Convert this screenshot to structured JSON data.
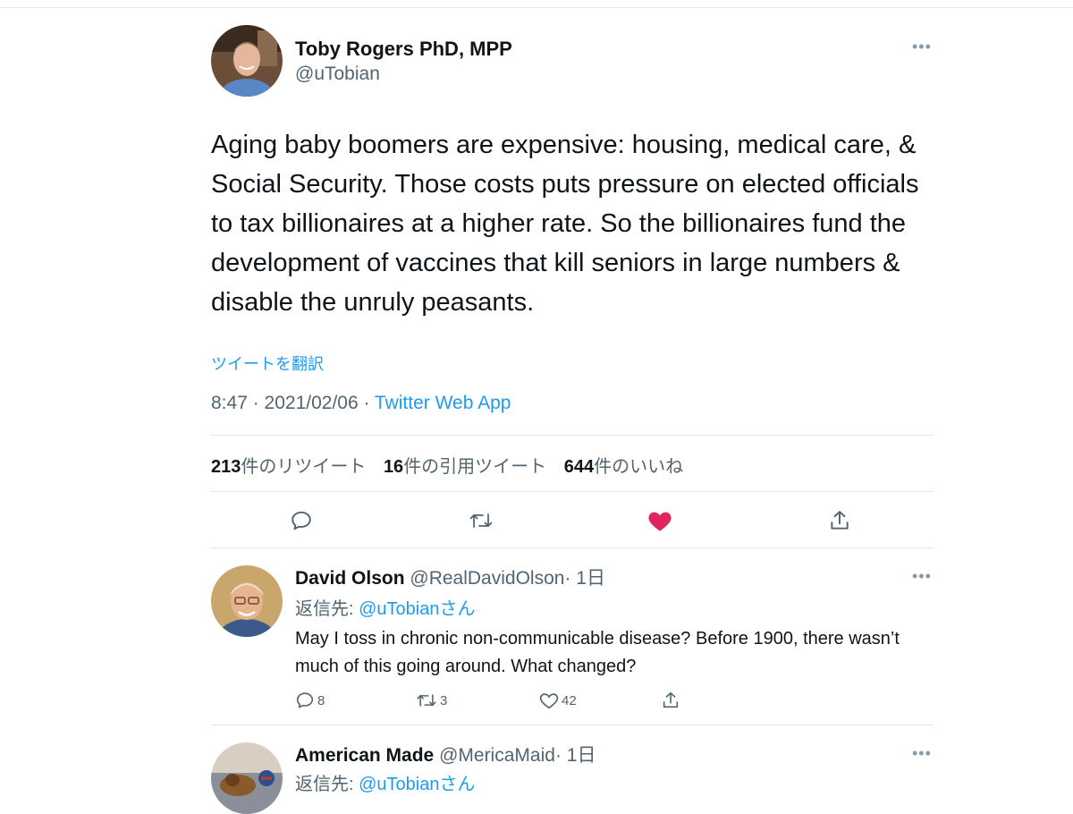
{
  "tweet": {
    "author": {
      "name": "Toby Rogers PhD, MPP",
      "handle": "@uTobian"
    },
    "more_icon": "more-icon",
    "text": "Aging baby boomers are expensive: housing, medical care, & Social Security. Those costs puts pressure on elected officials to tax billionaires at a higher rate. So the billionaires fund the development of vaccines that kill seniors in large numbers & disable the unruly peasants.",
    "translate_label": "ツイートを翻訳",
    "time": "8:47 · 2021/02/06 · ",
    "source": "Twitter Web App",
    "stats": {
      "retweets": {
        "count": "213",
        "label": "件のリツイート"
      },
      "quotes": {
        "count": "16",
        "label": "件の引用ツイート"
      },
      "likes": {
        "count": "644",
        "label": "件のいいね"
      }
    },
    "actions": [
      "reply-icon",
      "retweet-icon",
      "heart-filled-icon",
      "share-icon"
    ],
    "like_color": "#e0245e"
  },
  "replies": [
    {
      "name": "David Olson",
      "handle": "@RealDavidOlson",
      "time": "· 1日",
      "reply_to_label": "返信先: ",
      "reply_to_handle": "@uTobianさん",
      "text": "May I toss in chronic non-communicable disease?  Before 1900, there wasn’t much of this going around.  What changed?",
      "counts": {
        "reply": "8",
        "retweet": "3",
        "like": "42"
      }
    },
    {
      "name": "American Made",
      "handle": "@MericaMaid",
      "time": "· 1日",
      "reply_to_label": "返信先: ",
      "reply_to_handle": "@uTobianさん"
    }
  ],
  "colors": {
    "accent": "#1d9bf0",
    "secondary_text": "#536471",
    "divider": "#e1e8ed"
  }
}
